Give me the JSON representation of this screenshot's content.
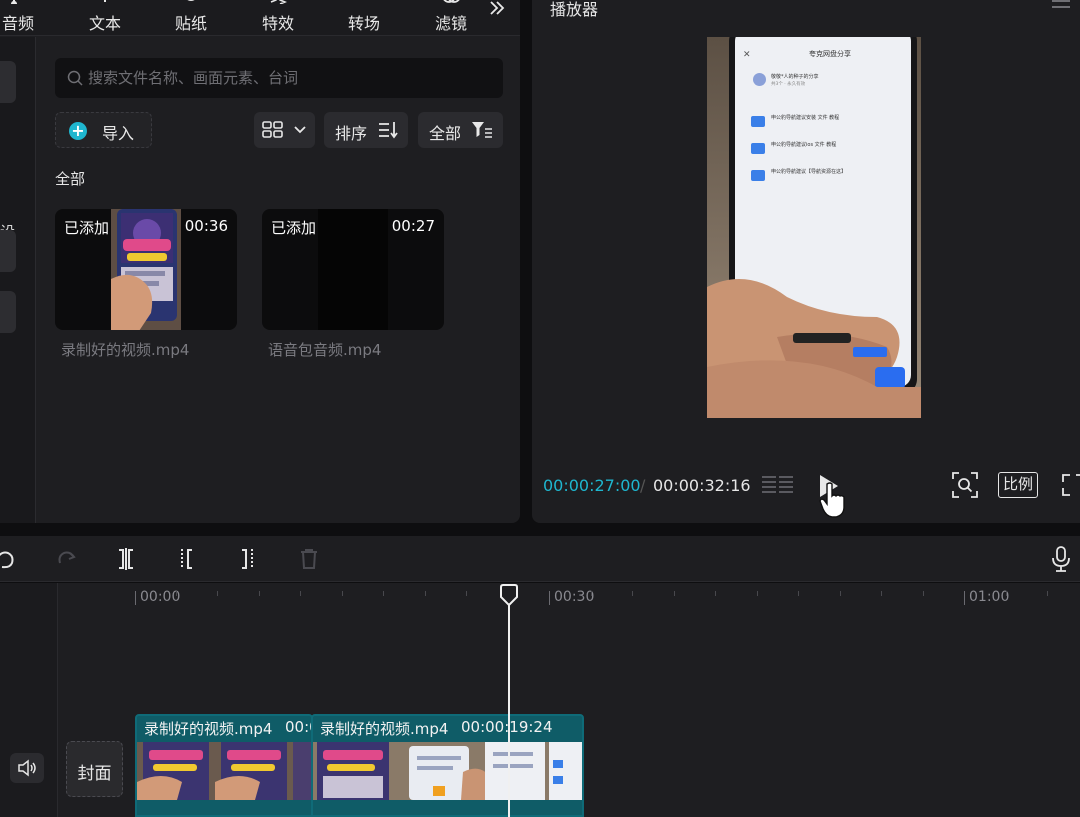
{
  "top_tabs": [
    {
      "label": "音频",
      "icon": "music-note-icon"
    },
    {
      "label": "文本",
      "icon": "text-icon"
    },
    {
      "label": "贴纸",
      "icon": "sticker-icon"
    },
    {
      "label": "特效",
      "icon": "sparkle-icon"
    },
    {
      "label": "转场",
      "icon": "transition-icon"
    },
    {
      "label": "滤镜",
      "icon": "filter-icon"
    }
  ],
  "side_glyph": "设",
  "search": {
    "placeholder": "搜索文件名称、画面元素、台词"
  },
  "import_label": "导入",
  "sort_label": "排序",
  "filter_label": "全部",
  "section_label": "全部",
  "media_items": [
    {
      "badge": "已添加",
      "duration": "00:36",
      "name": "录制好的视频.mp4"
    },
    {
      "badge": "已添加",
      "duration": "00:27",
      "name": "语音包音频.mp4"
    }
  ],
  "player": {
    "title": "播放器",
    "current_time": "00:00:27:00",
    "separator": "/",
    "total_time": "00:00:32:16",
    "ratio_label": "比例"
  },
  "phone_screen": {
    "header": "夸克网盘分享",
    "share_line": "敬敬*人的种子的分享",
    "sub_line": "共3个 · 永久有效",
    "folders": [
      "申公豹导航建议安装 文件 教程",
      "申公豹导航建议ios 文件 教程",
      "申公豹导航建议【导航资源在这】"
    ]
  },
  "ruler": [
    "00:00",
    "00:30",
    "01:00"
  ],
  "cover_label": "封面",
  "clips": [
    {
      "title": "录制好的视频.mp4",
      "duration": "00:0"
    },
    {
      "title": "录制好的视频.mp4",
      "duration": "00:00:19:24"
    }
  ],
  "colors": {
    "accent": "#1fb6cf",
    "clip": "#0f5c67",
    "panel": "#1e1e21"
  }
}
